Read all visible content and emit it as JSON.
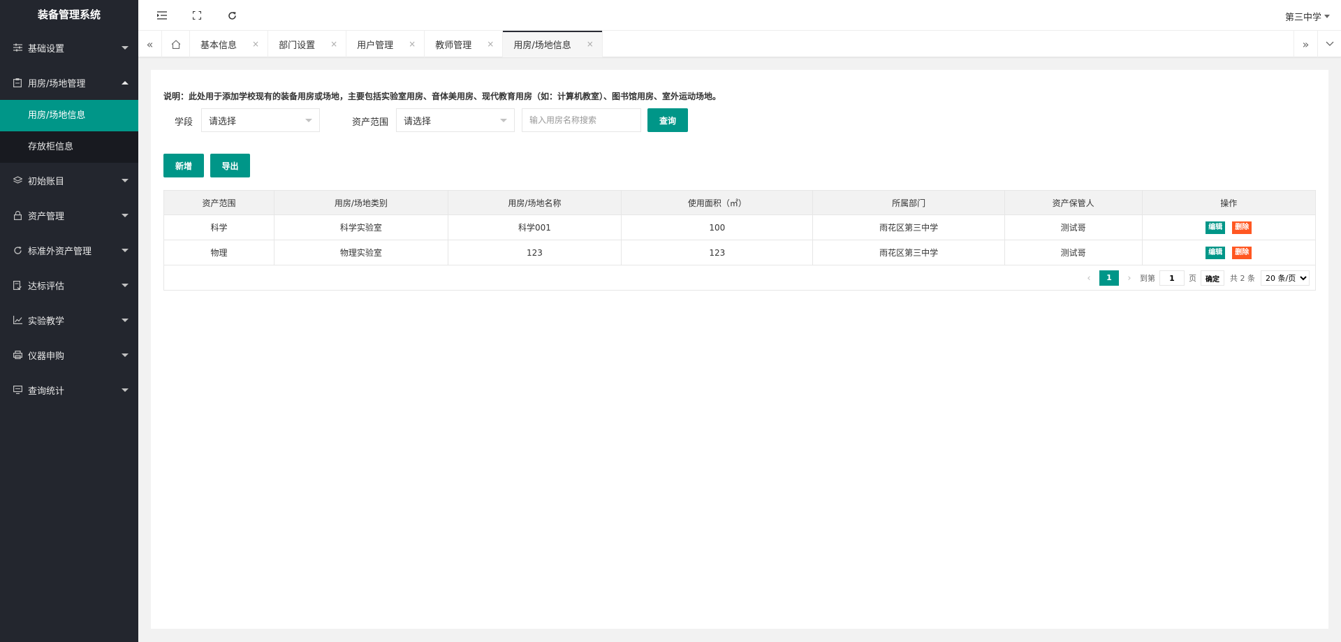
{
  "app": {
    "title": "装备管理系统"
  },
  "sidebar": {
    "items": [
      {
        "label": "基础设置",
        "icon": "sliders-icon"
      },
      {
        "label": "用房/场地管理",
        "icon": "clipboard-icon",
        "expanded": true,
        "children": [
          {
            "label": "用房/场地信息",
            "active": true
          },
          {
            "label": "存放柜信息"
          }
        ]
      },
      {
        "label": "初始账目",
        "icon": "layers-icon"
      },
      {
        "label": "资产管理",
        "icon": "lock-icon"
      },
      {
        "label": "标准外资产管理",
        "icon": "refresh-icon"
      },
      {
        "label": "达标评估",
        "icon": "document-check-icon"
      },
      {
        "label": "实验教学",
        "icon": "chart-icon"
      },
      {
        "label": "仪器申购",
        "icon": "printer-icon"
      },
      {
        "label": "查询统计",
        "icon": "monitor-icon"
      }
    ]
  },
  "header": {
    "user": "第三中学"
  },
  "tabs": {
    "items": [
      {
        "label": "基本信息"
      },
      {
        "label": "部门设置"
      },
      {
        "label": "用户管理"
      },
      {
        "label": "教师管理"
      },
      {
        "label": "用房/场地信息",
        "active": true
      }
    ],
    "close_glyph": "×"
  },
  "main": {
    "description": "说明：此处用于添加学校现有的装备用房或场地，主要包括实验室用房、音体美用房、现代教育用房（如：计算机教室）、图书馆用房、室外运动场地。",
    "filters": {
      "stage_label": "学段",
      "stage_value": "请选择",
      "scope_label": "资产范围",
      "scope_value": "请选择",
      "search_placeholder": "输入用房名称搜索",
      "query_label": "查询"
    },
    "actions": {
      "add_label": "新增",
      "export_label": "导出"
    },
    "table": {
      "columns": [
        "资产范围",
        "用房/场地类别",
        "用房/场地名称",
        "使用面积（㎡）",
        "所属部门",
        "资产保管人",
        "操作"
      ],
      "rows": [
        [
          "科学",
          "科学实验室",
          "科学001",
          "100",
          "雨花区第三中学",
          "测试哥"
        ],
        [
          "物理",
          "物理实验室",
          "123",
          "123",
          "雨花区第三中学",
          "测试哥"
        ]
      ],
      "edit_label": "编辑",
      "delete_label": "删除"
    },
    "pager": {
      "current_page": "1",
      "goto_prefix": "到第",
      "goto_value": "1",
      "goto_suffix": "页",
      "confirm_label": "确定",
      "total": "共 2 条",
      "page_size": "20 条/页"
    }
  },
  "colors": {
    "sidebar_bg": "#23262e",
    "accent": "#009688",
    "danger": "#ff5722"
  }
}
